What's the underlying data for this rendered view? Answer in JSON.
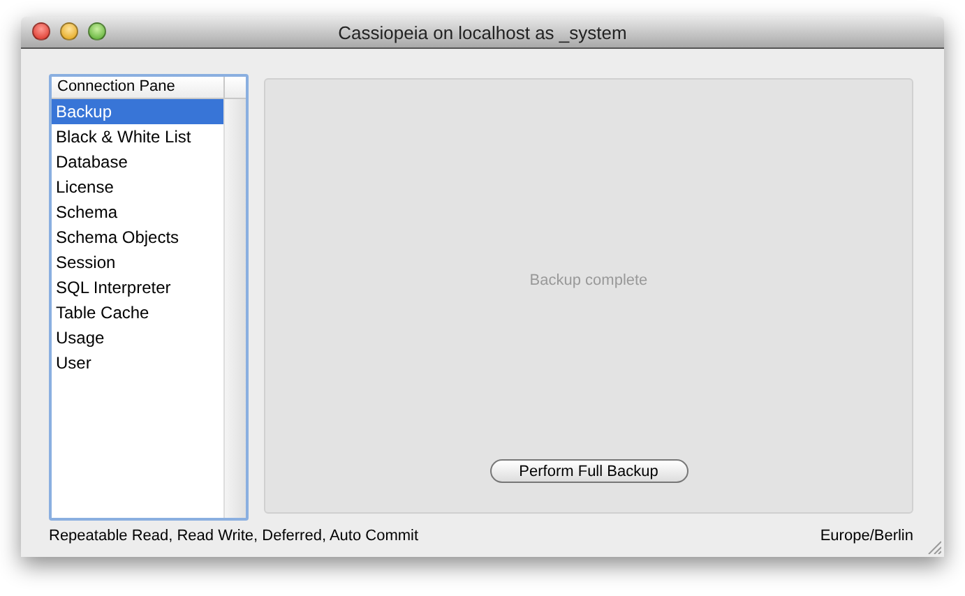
{
  "window": {
    "title": "Cassiopeia on localhost as _system"
  },
  "list": {
    "header": "Connection Pane",
    "items": [
      {
        "label": "Backup",
        "selected": true
      },
      {
        "label": "Black & White List",
        "selected": false
      },
      {
        "label": "Database",
        "selected": false
      },
      {
        "label": "License",
        "selected": false
      },
      {
        "label": "Schema",
        "selected": false
      },
      {
        "label": "Schema Objects",
        "selected": false
      },
      {
        "label": "Session",
        "selected": false
      },
      {
        "label": "SQL Interpreter",
        "selected": false
      },
      {
        "label": "Table Cache",
        "selected": false
      },
      {
        "label": "Usage",
        "selected": false
      },
      {
        "label": "User",
        "selected": false
      }
    ]
  },
  "panel": {
    "message": "Backup complete",
    "button": "Perform Full Backup"
  },
  "status_bar": {
    "left": "Repeatable Read, Read Write, Deferred, Auto Commit",
    "right": "Europe/Berlin"
  }
}
